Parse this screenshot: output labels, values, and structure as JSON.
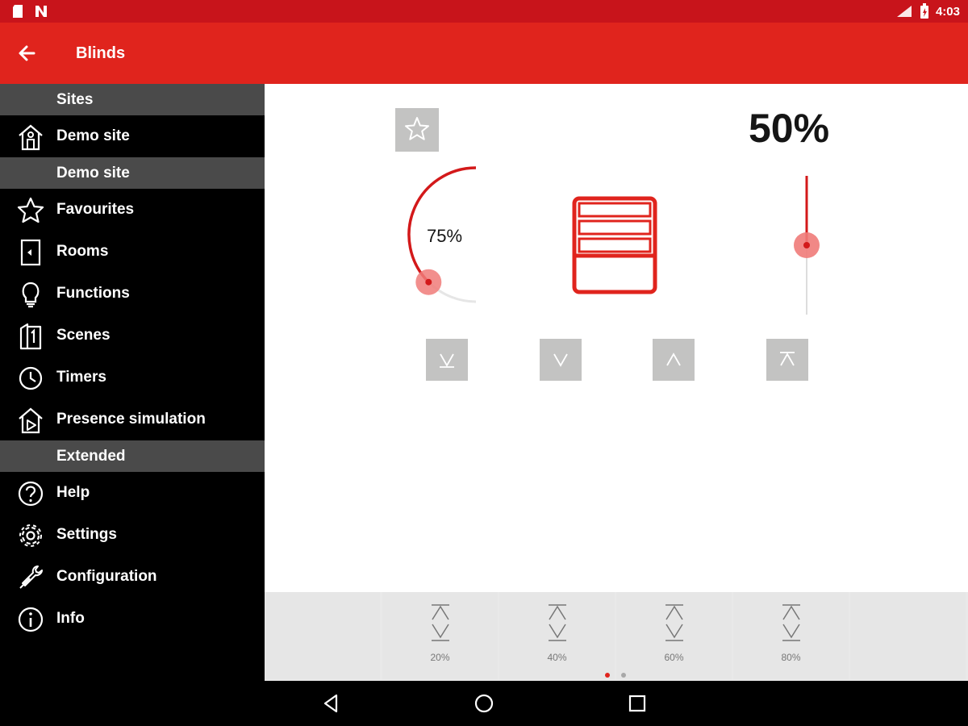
{
  "status": {
    "time": "4:03"
  },
  "app_bar": {
    "title": "Blinds"
  },
  "drawer": {
    "sections": [
      {
        "header": "Sites",
        "items": [
          {
            "label": "Demo site",
            "icon": "house-icon"
          }
        ]
      },
      {
        "header": "Demo site",
        "items": [
          {
            "label": "Favourites",
            "icon": "star-icon"
          },
          {
            "label": "Rooms",
            "icon": "door-icon"
          },
          {
            "label": "Functions",
            "icon": "bulb-icon"
          },
          {
            "label": "Scenes",
            "icon": "scenes-icon"
          },
          {
            "label": "Timers",
            "icon": "clock-icon"
          },
          {
            "label": "Presence simulation",
            "icon": "presence-icon"
          }
        ]
      },
      {
        "header": "Extended",
        "items": [
          {
            "label": "Help",
            "icon": "help-icon"
          },
          {
            "label": "Settings",
            "icon": "gear-icon"
          },
          {
            "label": "Configuration",
            "icon": "wrench-icon"
          },
          {
            "label": "Info",
            "icon": "info-icon"
          }
        ]
      }
    ]
  },
  "control": {
    "position_percent": "50%",
    "slat_angle_percent": "75%",
    "dial_level": 0.75,
    "slider_level": 0.5
  },
  "presets": [
    {
      "label": "20%"
    },
    {
      "label": "40%"
    },
    {
      "label": "60%"
    },
    {
      "label": "80%"
    }
  ],
  "page_indicator": {
    "pages": 2,
    "active": 1
  },
  "colors": {
    "accent": "#e0241d",
    "status": "#c8141b",
    "drawer": "#000000",
    "section": "#4a4a4a"
  }
}
